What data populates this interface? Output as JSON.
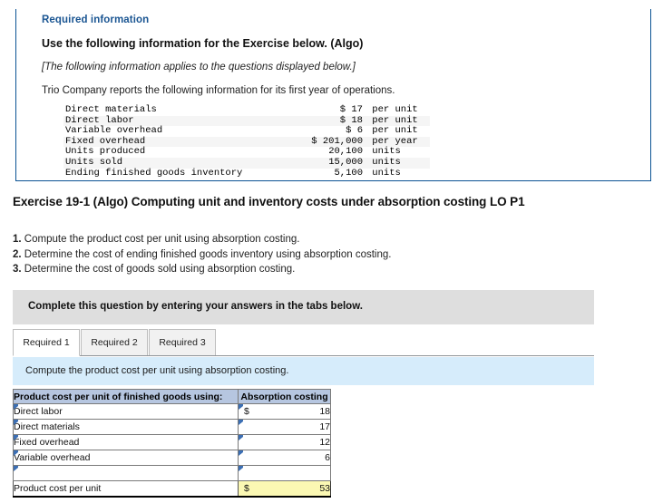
{
  "required_info": {
    "panel_title": "Required information",
    "heading": "Use the following information for the Exercise below. (Algo)",
    "applies_note": "[The following information applies to the questions displayed below.]",
    "lead_in": "Trio Company reports the following information for its first year of operations.",
    "facts": [
      {
        "label": "Direct materials",
        "currency": "$",
        "amount": "17",
        "unit": "per unit"
      },
      {
        "label": "Direct labor",
        "currency": "$",
        "amount": "18",
        "unit": "per unit"
      },
      {
        "label": "Variable overhead",
        "currency": "$",
        "amount": "6",
        "unit": "per unit"
      },
      {
        "label": "Fixed overhead",
        "currency": "$",
        "amount": "201,000",
        "unit": "per year"
      },
      {
        "label": "Units produced",
        "currency": "",
        "amount": "20,100",
        "unit": "units"
      },
      {
        "label": "Units sold",
        "currency": "",
        "amount": "15,000",
        "unit": "units"
      },
      {
        "label": "Ending finished goods inventory",
        "currency": "",
        "amount": "5,100",
        "unit": "units"
      }
    ]
  },
  "exercise": {
    "title": "Exercise 19-1 (Algo) Computing unit and inventory costs under absorption costing LO P1",
    "requirements": [
      {
        "number": "1.",
        "text": "Compute the product cost per unit using absorption costing."
      },
      {
        "number": "2.",
        "text": "Determine the cost of ending finished goods inventory using absorption costing."
      },
      {
        "number": "3.",
        "text": "Determine the cost of goods sold using absorption costing."
      }
    ]
  },
  "instruction_bar": {
    "text": "Complete this question by entering your answers in the tabs below."
  },
  "tabs": [
    {
      "label": "Required 1",
      "active": true
    },
    {
      "label": "Required 2",
      "active": false
    },
    {
      "label": "Required 3",
      "active": false
    }
  ],
  "prompt_bar": {
    "text": "Compute the product cost per unit using absorption costing."
  },
  "answer_table": {
    "headers": {
      "label": "Product cost per unit of finished goods using:",
      "value": "Absorption costing"
    },
    "rows": [
      {
        "label": "Direct labor",
        "currency": "$",
        "value": "18"
      },
      {
        "label": "Direct materials",
        "currency": "",
        "value": "17"
      },
      {
        "label": "Fixed overhead",
        "currency": "",
        "value": "12"
      },
      {
        "label": "Variable overhead",
        "currency": "",
        "value": "6"
      },
      {
        "label": "",
        "currency": "",
        "value": ""
      }
    ],
    "total_row": {
      "label": "Product cost per unit",
      "currency": "$",
      "value": "53"
    }
  },
  "colors": {
    "panel_border": "#0b5394",
    "panel_title": "#1a5592",
    "gray_bar": "#dedede",
    "prompt_bar": "#d6ecfb",
    "table_header": "#b6c6e0",
    "total_highlight": "#fbf8b3",
    "cell_border": "#5b84c4"
  }
}
